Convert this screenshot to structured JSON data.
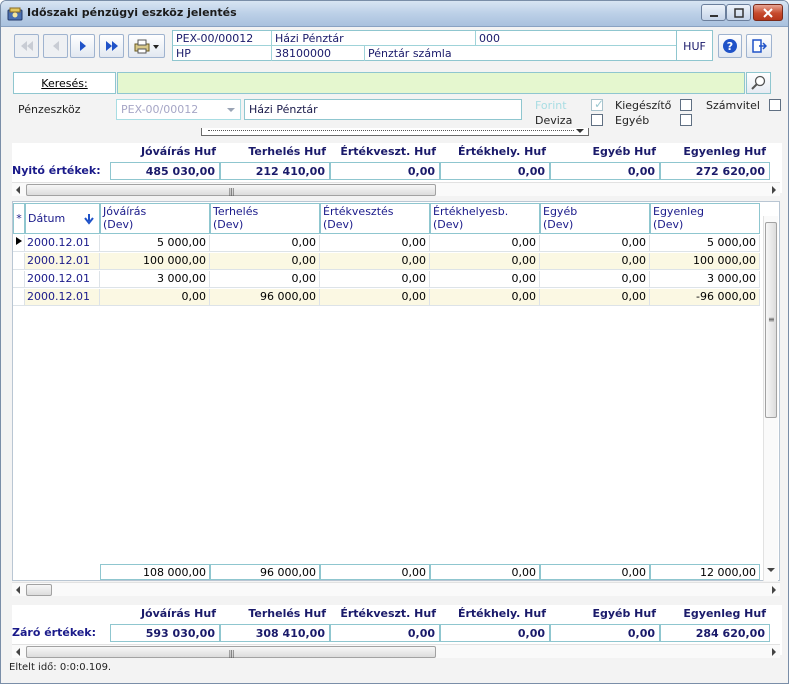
{
  "window": {
    "title": "Időszaki pénzügyi eszköz jelentés"
  },
  "toolbar": {
    "buttons": [
      "first-record",
      "previous-record",
      "next-record",
      "last-record",
      "print-menu"
    ]
  },
  "docinfo": {
    "code": "PEX-00/00012",
    "name": "Házi Pénztár",
    "number": "000",
    "short": "HP",
    "account": "38100000",
    "account_name": "Pénztár számla",
    "currency": "HUF"
  },
  "search": {
    "label": "Keresés:",
    "value": ""
  },
  "filter": {
    "asset_label": "Pénzeszköz",
    "asset_code": "PEX-00/00012",
    "asset_name": "Házi Pénztár",
    "forint_label": "Forint",
    "deviza_label": "Deviza",
    "kiegeszito_label": "Kiegészítő",
    "egyeb_label": "Egyéb",
    "szamvitel_label": "Számvitel",
    "forint_checked": true,
    "deviza_checked": false,
    "kiegeszito_checked": false,
    "egyeb_checked": false,
    "szamvitel_checked": false
  },
  "opening": {
    "label": "Nyitó értékek:",
    "headers": [
      "Jóváírás Huf",
      "Terhelés Huf",
      "Értékveszt. Huf",
      "Értékhely. Huf",
      "Egyéb Huf",
      "Egyenleg Huf"
    ],
    "values": [
      "485 030,00",
      "212 410,00",
      "0,00",
      "0,00",
      "0,00",
      "272 620,00"
    ]
  },
  "table": {
    "row_marker_header": "*",
    "date_header": "Dátum",
    "columns": [
      "Jóváírás\n(Dev)",
      "Terhelés\n(Dev)",
      "Értékvesztés\n(Dev)",
      "Értékhelyesb.\n(Dev)",
      "Egyéb\n(Dev)",
      "Egyenleg\n(Dev)"
    ],
    "rows": [
      {
        "date": "2000.12.01",
        "values": [
          "5 000,00",
          "0,00",
          "0,00",
          "0,00",
          "0,00",
          "5 000,00"
        ]
      },
      {
        "date": "2000.12.01",
        "values": [
          "100 000,00",
          "0,00",
          "0,00",
          "0,00",
          "0,00",
          "100 000,00"
        ]
      },
      {
        "date": "2000.12.01",
        "values": [
          "3 000,00",
          "0,00",
          "0,00",
          "0,00",
          "0,00",
          "3 000,00"
        ]
      },
      {
        "date": "2000.12.01",
        "values": [
          "0,00",
          "96 000,00",
          "0,00",
          "0,00",
          "0,00",
          "-96 000,00"
        ]
      }
    ],
    "totals": [
      "108 000,00",
      "96 000,00",
      "0,00",
      "0,00",
      "0,00",
      "12 000,00"
    ]
  },
  "closing": {
    "label": "Záró értékek:",
    "headers": [
      "Jóváírás Huf",
      "Terhelés Huf",
      "Értékveszt. Huf",
      "Értékhely. Huf",
      "Egyéb Huf",
      "Egyenleg Huf"
    ],
    "values": [
      "593 030,00",
      "308 410,00",
      "0,00",
      "0,00",
      "0,00",
      "284 620,00"
    ]
  },
  "status": {
    "text": "Eltelt idő: 0:0:0.109."
  },
  "colors": {
    "accent": "#1a1a8a",
    "row_alt": "#fbf8e3",
    "search_bg": "#e5f7cf",
    "border": "#8fc6cf"
  }
}
